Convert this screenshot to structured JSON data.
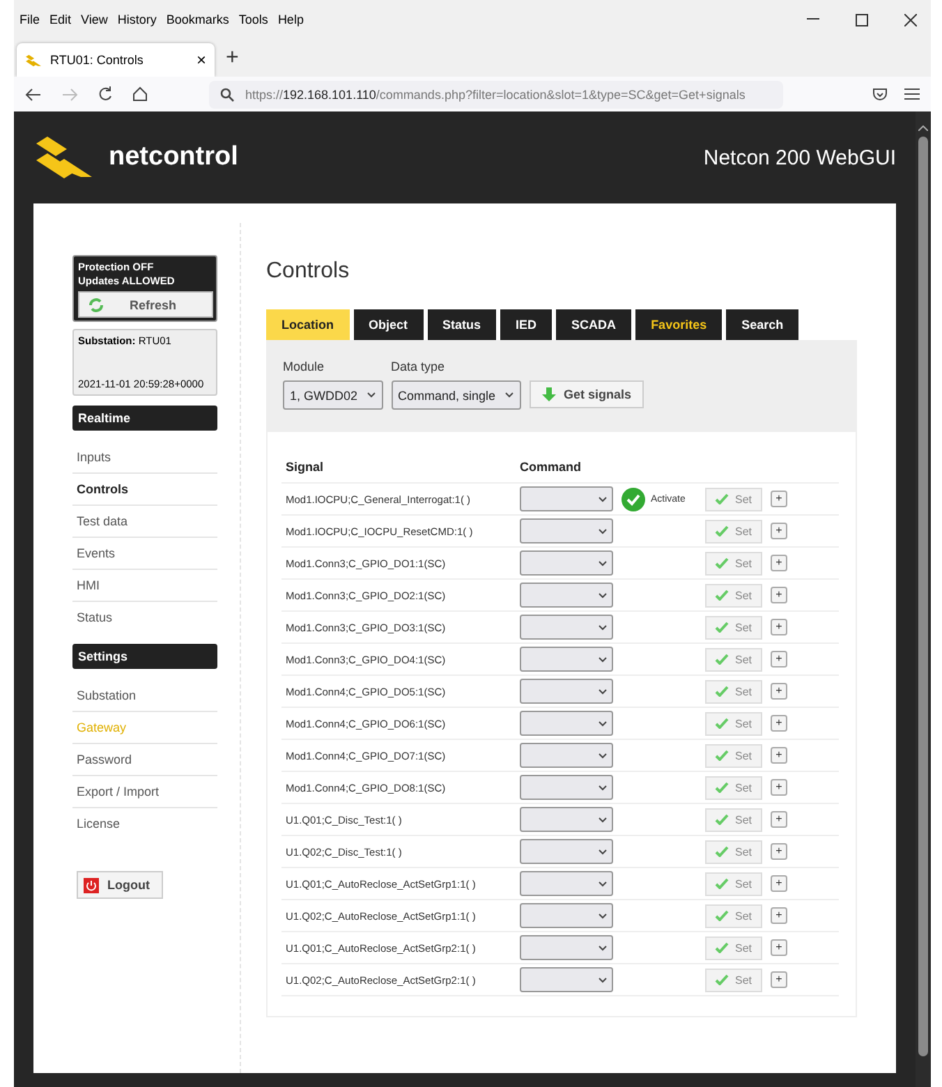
{
  "menu_bar": [
    "File",
    "Edit",
    "View",
    "History",
    "Bookmarks",
    "Tools",
    "Help"
  ],
  "browser_tab": {
    "title": "RTU01: Controls",
    "close": "×",
    "new_tab": "+"
  },
  "address_bar": {
    "scheme": "https://",
    "host": "192.168.101.110",
    "path": "/commands.php?filter=location&slot=1&type=SC&get=Get+signals"
  },
  "header": {
    "brand": "netcontrol",
    "product": "Netcon 200 WebGUI"
  },
  "sidebar": {
    "status_lines": [
      "Protection OFF",
      "Updates ALLOWED"
    ],
    "refresh": "Refresh",
    "substation_label": "Substation:",
    "substation": "RTU01",
    "timestamp": "2021-11-01 20:59:28+0000",
    "sections": [
      {
        "title": "Realtime",
        "items": [
          {
            "label": "Inputs",
            "selected": false,
            "highlighted": false
          },
          {
            "label": "Controls",
            "selected": true,
            "highlighted": false
          },
          {
            "label": "Test data",
            "selected": false,
            "highlighted": false
          },
          {
            "label": "Events",
            "selected": false,
            "highlighted": false
          },
          {
            "label": "HMI",
            "selected": false,
            "highlighted": false
          },
          {
            "label": "Status",
            "selected": false,
            "highlighted": false
          }
        ]
      },
      {
        "title": "Settings",
        "items": [
          {
            "label": "Substation",
            "selected": false,
            "highlighted": false
          },
          {
            "label": "Gateway",
            "selected": false,
            "highlighted": true
          },
          {
            "label": "Password",
            "selected": false,
            "highlighted": false
          },
          {
            "label": "Export / Import",
            "selected": false,
            "highlighted": false
          },
          {
            "label": "License",
            "selected": false,
            "highlighted": false
          }
        ]
      }
    ],
    "logout": "Logout"
  },
  "page_title": "Controls",
  "tabs": [
    {
      "label": "Location",
      "selected": true,
      "highlighted": false
    },
    {
      "label": "Object",
      "selected": false,
      "highlighted": false
    },
    {
      "label": "Status",
      "selected": false,
      "highlighted": false
    },
    {
      "label": "IED",
      "selected": false,
      "highlighted": false
    },
    {
      "label": "SCADA",
      "selected": false,
      "highlighted": false
    },
    {
      "label": "Favorites",
      "selected": false,
      "highlighted": true
    },
    {
      "label": "Search",
      "selected": false,
      "highlighted": false
    }
  ],
  "filters": {
    "module_label": "Module",
    "module": "1, GWDD02",
    "data_type_label": "Data type",
    "data_type": "Command, single",
    "get_signals": "Get signals"
  },
  "table": {
    "columns": [
      "Signal",
      "Command"
    ],
    "rows": [
      {
        "signal": "Mod1.IOCPU;C_General_Interrogat:1( )",
        "status": "Activate",
        "set": "Set",
        "add": "+"
      },
      {
        "signal": "Mod1.IOCPU;C_IOCPU_ResetCMD:1( )",
        "set": "Set",
        "add": "+"
      },
      {
        "signal": "Mod1.Conn3;C_GPIO_DO1:1(SC)",
        "set": "Set",
        "add": "+"
      },
      {
        "signal": "Mod1.Conn3;C_GPIO_DO2:1(SC)",
        "set": "Set",
        "add": "+"
      },
      {
        "signal": "Mod1.Conn3;C_GPIO_DO3:1(SC)",
        "set": "Set",
        "add": "+"
      },
      {
        "signal": "Mod1.Conn3;C_GPIO_DO4:1(SC)",
        "set": "Set",
        "add": "+"
      },
      {
        "signal": "Mod1.Conn4;C_GPIO_DO5:1(SC)",
        "set": "Set",
        "add": "+"
      },
      {
        "signal": "Mod1.Conn4;C_GPIO_DO6:1(SC)",
        "set": "Set",
        "add": "+"
      },
      {
        "signal": "Mod1.Conn4;C_GPIO_DO7:1(SC)",
        "set": "Set",
        "add": "+"
      },
      {
        "signal": "Mod1.Conn4;C_GPIO_DO8:1(SC)",
        "set": "Set",
        "add": "+"
      },
      {
        "signal": "U1.Q01;C_Disc_Test:1( )",
        "set": "Set",
        "add": "+"
      },
      {
        "signal": "U1.Q02;C_Disc_Test:1( )",
        "set": "Set",
        "add": "+"
      },
      {
        "signal": "U1.Q01;C_AutoReclose_ActSetGrp1:1( )",
        "set": "Set",
        "add": "+"
      },
      {
        "signal": "U1.Q02;C_AutoReclose_ActSetGrp1:1( )",
        "set": "Set",
        "add": "+"
      },
      {
        "signal": "U1.Q01;C_AutoReclose_ActSetGrp2:1( )",
        "set": "Set",
        "add": "+"
      },
      {
        "signal": "U1.Q02;C_AutoReclose_ActSetGrp2:1( )",
        "set": "Set",
        "add": "+"
      }
    ]
  }
}
